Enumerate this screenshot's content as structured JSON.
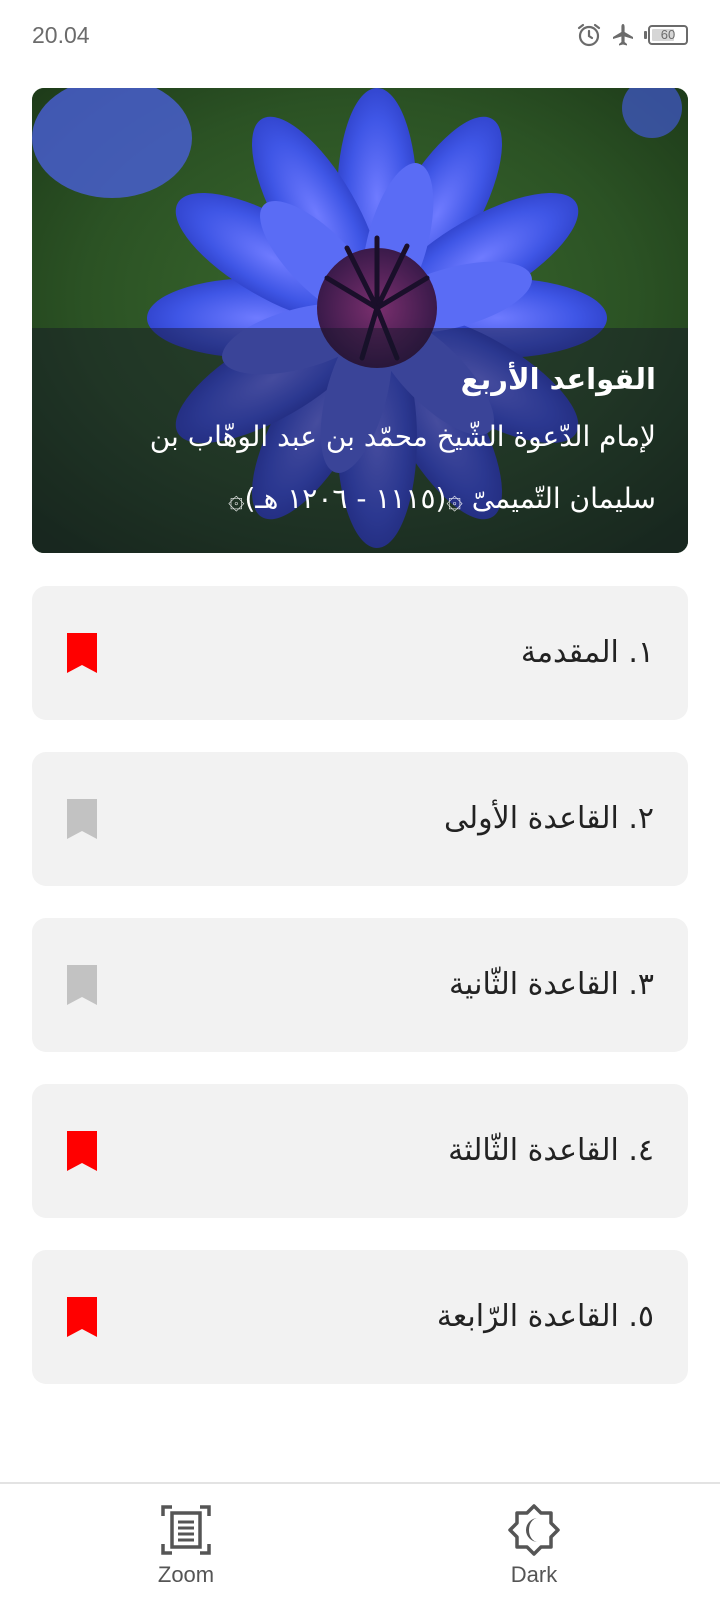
{
  "status_bar": {
    "time": "20.04",
    "battery": "60",
    "icons": [
      "alarm-icon",
      "airplane-icon",
      "battery-icon"
    ]
  },
  "hero": {
    "title": "القواعد الأربع",
    "subtitle_line1": "لإمام الدّعوة الشّيخ محمّد بن عبد الوهّاب بن",
    "subtitle_line2": "سليمان التّميمىّ ۞(١١١٥ - ١٢٠٦ هـ)۞",
    "image": "blue-cornflower-photo"
  },
  "chapters": [
    {
      "label": "١. المقدمة",
      "bookmarked": true
    },
    {
      "label": "٢. القاعدة الأولى",
      "bookmarked": false
    },
    {
      "label": "٣. القاعدة الثّانية",
      "bookmarked": false
    },
    {
      "label": "٤. القاعدة الثّالثة",
      "bookmarked": true
    },
    {
      "label": "٥. القاعدة الرّابعة",
      "bookmarked": true
    }
  ],
  "bottom_nav": {
    "zoom_label": "Zoom",
    "dark_label": "Dark"
  },
  "colors": {
    "bookmark_active": "#ff0000",
    "bookmark_inactive": "#c2c2c2",
    "card_background": "#f2f2f2",
    "nav_icon": "#555555"
  }
}
